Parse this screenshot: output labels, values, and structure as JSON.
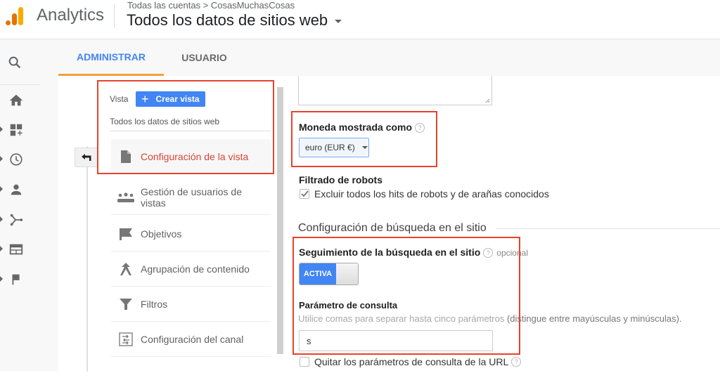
{
  "header": {
    "brand": "Analytics",
    "breadcrumb": "Todas las cuentas > CosasMuchasCosas",
    "view_title": "Todos los datos de sitios web"
  },
  "leftnav": {
    "icons": [
      "search-icon",
      "home-icon",
      "customization-icon",
      "realtime-icon",
      "audience-icon",
      "acquisition-icon",
      "behavior-icon",
      "conversions-icon"
    ]
  },
  "tabs": [
    {
      "label": "ADMINISTRAR",
      "active": true
    },
    {
      "label": "USUARIO",
      "active": false
    }
  ],
  "view_column": {
    "vista_label": "Vista",
    "create_button": "Crear vista",
    "view_name": "Todos los datos de sitios web",
    "items": [
      {
        "label": "Configuración de la vista",
        "icon": "document-icon",
        "active": true
      },
      {
        "label": "Gestión de usuarios de vistas",
        "icon": "users-icon",
        "active": false
      },
      {
        "label": "Objetivos",
        "icon": "flag-icon",
        "active": false
      },
      {
        "label": "Agrupación de contenido",
        "icon": "content-grouping-icon",
        "active": false
      },
      {
        "label": "Filtros",
        "icon": "filter-icon",
        "active": false
      },
      {
        "label": "Configuración del canal",
        "icon": "channel-settings-icon",
        "active": false
      }
    ]
  },
  "settings": {
    "currency_label": "Moneda mostrada como",
    "currency_value": "euro (EUR €)",
    "bot_filter_label": "Filtrado de robots",
    "bot_filter_checkbox": "Excluir todos los hits de robots y de arañas conocidos",
    "bot_filter_checked": true,
    "site_search_section": "Configuración de búsqueda en el sitio",
    "site_search_tracking_label": "Seguimiento de la búsqueda en el sitio",
    "optional_label": "opcional",
    "toggle_label": "ACTIVA",
    "toggle_on": true,
    "query_param_label": "Parámetro de consulta",
    "query_param_hint_a": "Utilice comas para separar hasta cinco parámetros",
    "query_param_hint_b": " (distingue entre mayúsculas y minúsculas).",
    "query_param_value": "s",
    "strip_params_label": "Quitar los parámetros de consulta de la URL",
    "strip_params_checked": false,
    "help_glyph": "?"
  },
  "colors": {
    "accent_blue": "#4285f4",
    "tab_underline": "#f4a03b",
    "active_item_red": "#db4437",
    "highlight_box": "#e8432c"
  }
}
